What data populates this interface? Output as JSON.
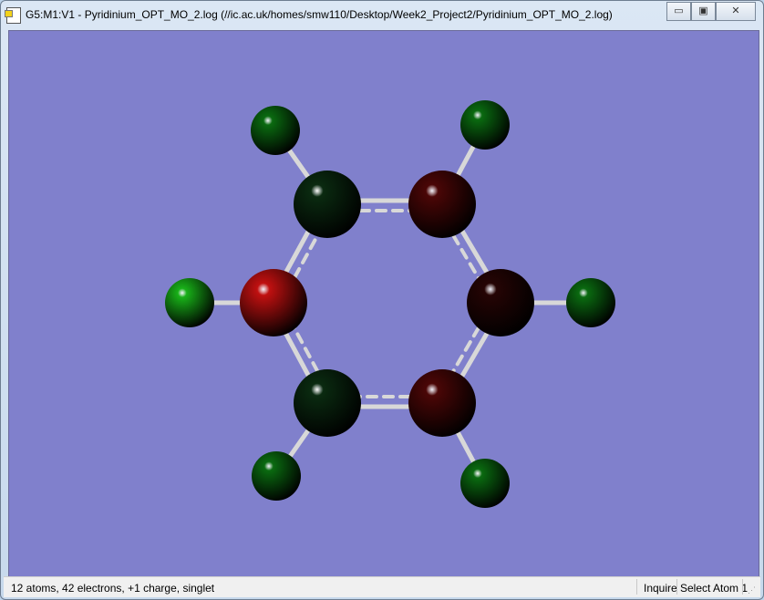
{
  "window": {
    "title": "G5:M1:V1 - Pyridinium_OPT_MO_2.log (//ic.ac.uk/homes/smw110/Desktop/Week2_Project2/Pyridinium_OPT_MO_2.log)",
    "minimize": "▭",
    "maximize": "▣",
    "close": "✕"
  },
  "viewport": {
    "background": "#8080cc",
    "atoms": [
      {
        "element": "C",
        "color": "#0a2a10"
      },
      {
        "element": "C",
        "color": "#4a0606"
      },
      {
        "element": "N",
        "color": "#c01010"
      },
      {
        "element": "C",
        "color": "#250404"
      },
      {
        "element": "C",
        "color": "#0a2a10"
      },
      {
        "element": "C",
        "color": "#4a0606"
      },
      {
        "element": "H",
        "color": "#0a6a10"
      },
      {
        "element": "H",
        "color": "#0a6a10"
      },
      {
        "element": "H",
        "color": "#18b018"
      },
      {
        "element": "H",
        "color": "#0a6a10"
      },
      {
        "element": "H",
        "color": "#0a6a10"
      },
      {
        "element": "H",
        "color": "#0a6a10"
      }
    ]
  },
  "status": {
    "info": "12 atoms, 42 electrons, +1 charge, singlet",
    "mode": "Inquire",
    "action": "Select Atom 1"
  }
}
